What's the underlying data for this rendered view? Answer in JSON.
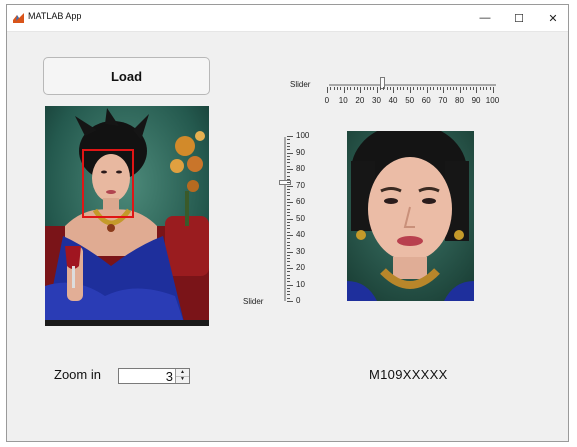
{
  "window": {
    "title": "MATLAB App",
    "minimize_symbol": "—",
    "maximize_symbol": "☐",
    "close_symbol": "✕"
  },
  "load_button": {
    "label": "Load"
  },
  "images": {
    "original": {
      "icon": "photo-image",
      "face_box_color": "#e01515"
    },
    "cropped_face": {
      "icon": "photo-image"
    }
  },
  "horizontal_slider": {
    "label": "Slider",
    "value": 33,
    "min": 0,
    "max": 100,
    "ticks": [
      "0",
      "10",
      "20",
      "30",
      "40",
      "50",
      "60",
      "70",
      "80",
      "90",
      "100"
    ]
  },
  "vertical_slider": {
    "label": "Slider",
    "value": 72,
    "min": 0,
    "max": 100,
    "ticks": [
      "0",
      "10",
      "20",
      "30",
      "40",
      "50",
      "60",
      "70",
      "80",
      "90",
      "100"
    ]
  },
  "zoom": {
    "label": "Zoom in",
    "value": "3",
    "up_symbol": "▲",
    "down_symbol": "▼"
  },
  "student_id": {
    "text": "M109XXXXX"
  },
  "colors": {
    "background": "#f0f0f0",
    "face_box": "#e01515",
    "dress_blue": "#1e2f9c",
    "backdrop_green": "#2a6b5e"
  }
}
